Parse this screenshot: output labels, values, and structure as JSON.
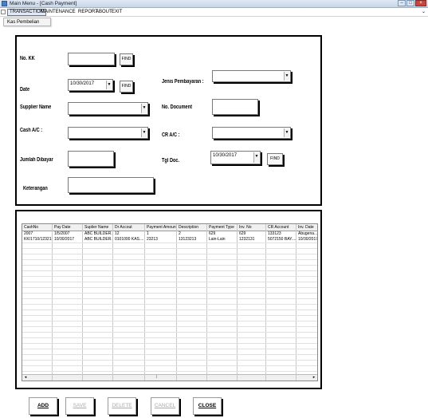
{
  "window": {
    "title": "Main Menu - [Cash Payment]"
  },
  "menu": {
    "items": [
      "TRANSACTION",
      "MAINTENANCE",
      "REPORT",
      "ABOUT",
      "EXIT"
    ],
    "dropdown_item": "Kas Pembelian"
  },
  "form": {
    "no_kk_label": "No. KK",
    "find_label": "FIND",
    "date_label": "Date",
    "date_value": "10/30/2017",
    "supplier_label": "Supplier Name",
    "cash_ac_label": "Cash A/C :",
    "jumlah_label": "Jumlah Dibayar",
    "keterangan_label": "Keterangan",
    "jenis_label": "Jenis Pembayaran :",
    "no_document_label": "No. Document",
    "cr_ac_label": "CR A/C :",
    "tgl_doc_label": "Tgl Doc.",
    "tgl_doc_value": "10/30/2017"
  },
  "grid": {
    "columns": [
      "CashNo",
      "Pay Date",
      "Suplier Name",
      "Dr Accout",
      "Payment Amount",
      "Description",
      "Payment Type",
      "Inv. No",
      "CR Account",
      "Inv. Date"
    ],
    "rows": [
      [
        "2007",
        "1/5/2007",
        "ABC BUILDER....",
        "12",
        "1",
        "2",
        "629",
        "629",
        "133123",
        "Abugena...Jaa"
      ],
      [
        "KK/1710/123213",
        "10/30/2017",
        "ABC BUILDER....",
        "0101000 KAS....",
        "23213",
        "13123213",
        "Lain-Lain",
        "1232131",
        "5072150 BAY....",
        "10/30/2017"
      ]
    ]
  },
  "buttons": {
    "add": "ADD",
    "save": "SAVE",
    "delete": "DELETE",
    "cancel": "CANCEL",
    "close": "CLOSE"
  }
}
